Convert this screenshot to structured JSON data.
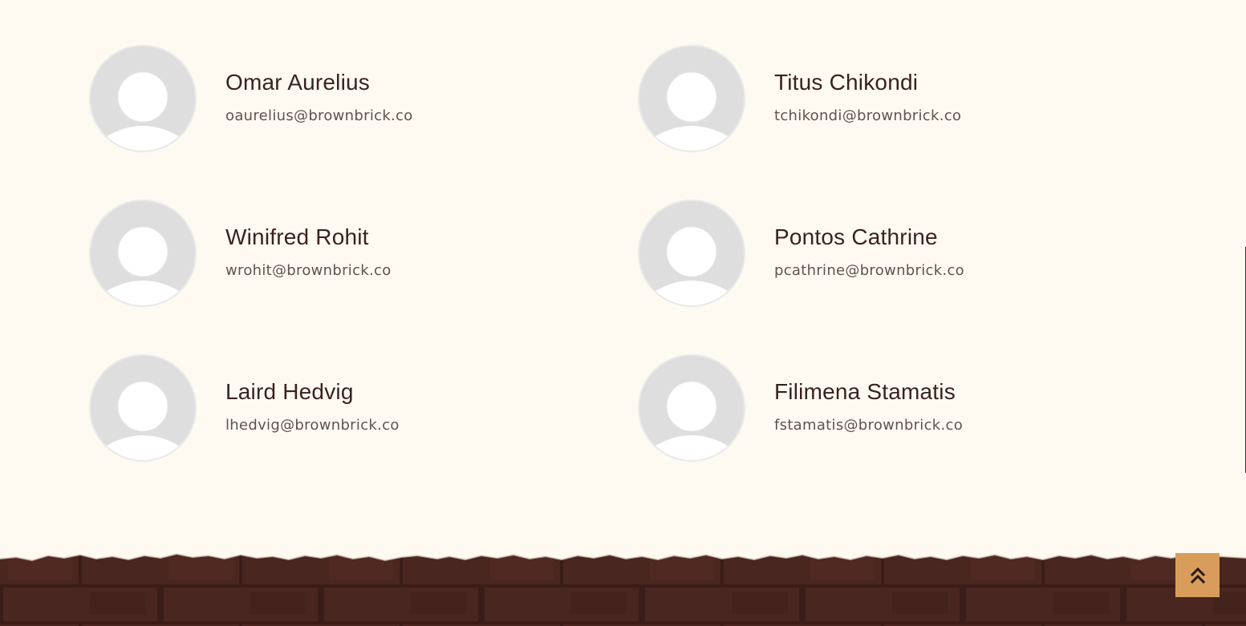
{
  "team": [
    {
      "name": "Omar Aurelius",
      "email": "oaurelius@brownbrick.co"
    },
    {
      "name": "Titus Chikondi",
      "email": "tchikondi@brownbrick.co"
    },
    {
      "name": "Winifred Rohit",
      "email": "wrohit@brownbrick.co"
    },
    {
      "name": "Pontos Cathrine",
      "email": "pcathrine@brownbrick.co"
    },
    {
      "name": "Laird Hedvig",
      "email": "lhedvig@brownbrick.co"
    },
    {
      "name": "Filimena Stamatis",
      "email": "fstamatis@brownbrick.co"
    }
  ],
  "icons": {
    "avatar": "user-placeholder-icon",
    "back_to_top": "double-chevron-up-icon"
  },
  "colors": {
    "page_background": "#fefaf1",
    "name_text": "#3a2221",
    "email_text": "#5e5350",
    "avatar_fill": "#dedede",
    "footer_brick": "#4a2620",
    "back_to_top_bg": "#d89d5b"
  }
}
